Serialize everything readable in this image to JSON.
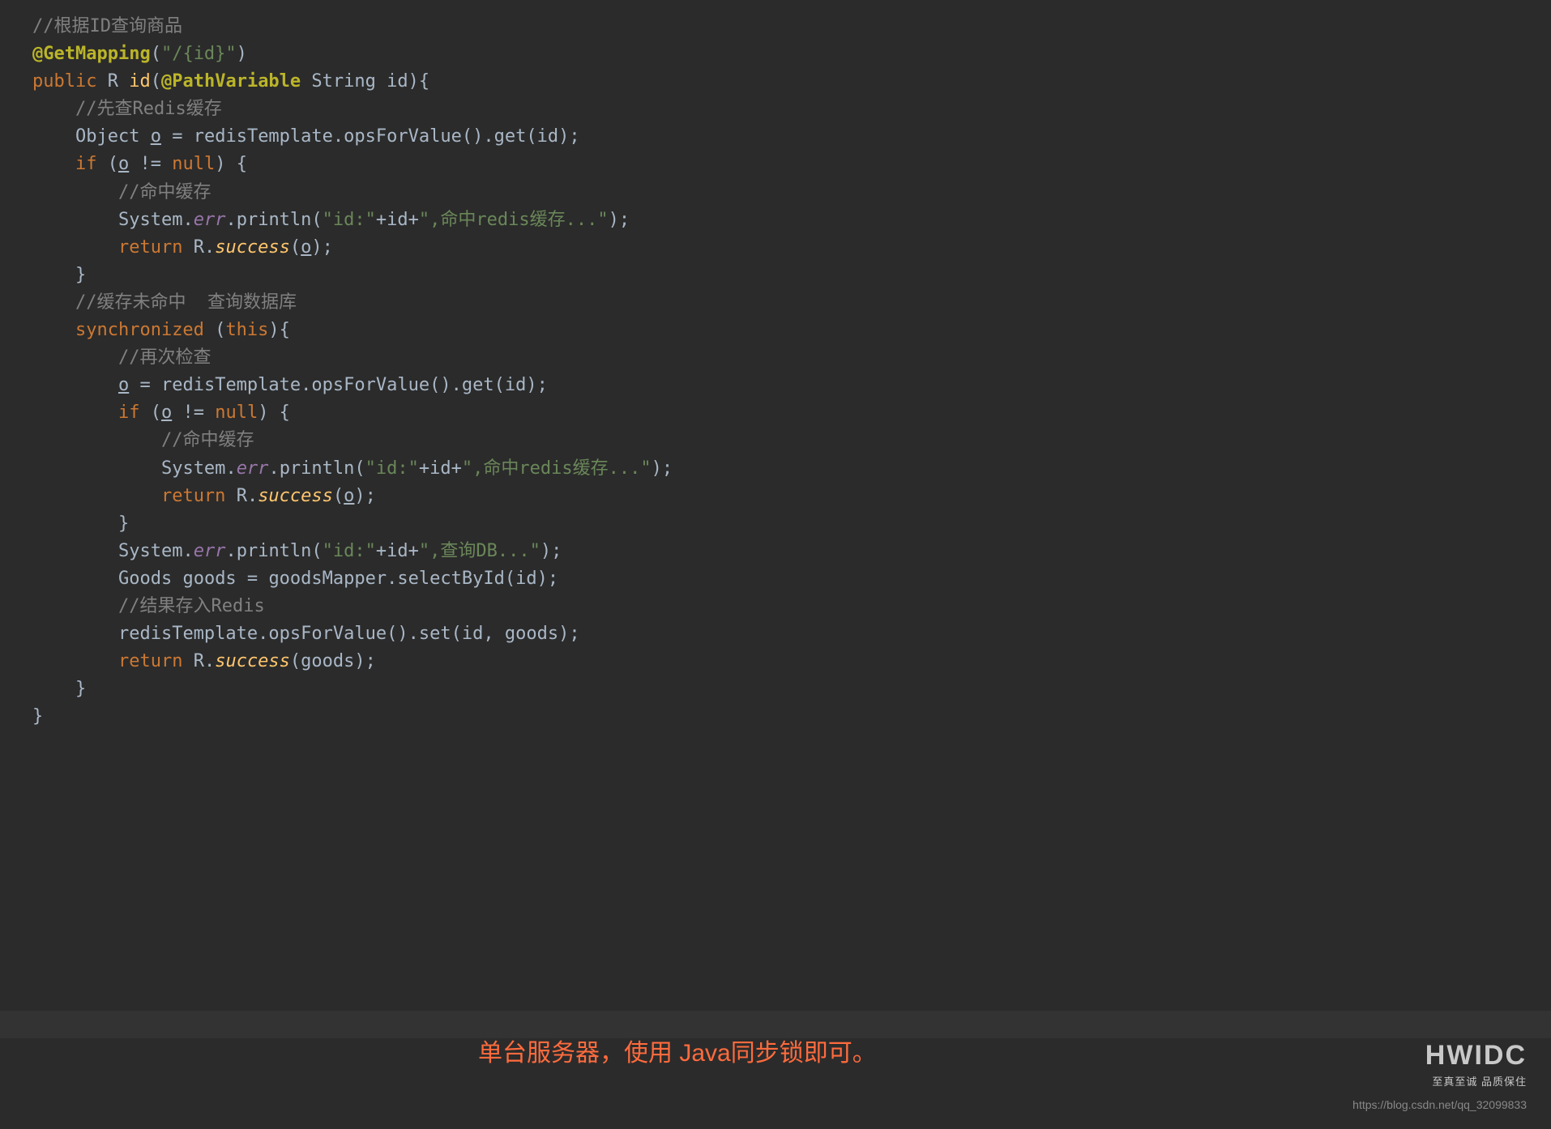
{
  "code": {
    "line1_comment": "//根据ID查询商品",
    "line2_annotation": "@GetMapping",
    "line2_string": "\"/{id}\"",
    "line3_kw_public": "public",
    "line3_type_R": "R",
    "line3_method": "id",
    "line3_anno": "@PathVariable",
    "line3_param_type": "String",
    "line3_param_name": "id",
    "line4_comment": "//先查Redis缓存",
    "line5_type": "Object",
    "line5_var": "o",
    "line5_eq": " = ",
    "line5_redis": "redisTemplate",
    "line5_m1": "opsForValue",
    "line5_m2": "get",
    "line5_arg": "id",
    "line6_kw": "if",
    "line6_cond_var": "o",
    "line6_cond_op": " != ",
    "line6_cond_null": "null",
    "line7_comment": "//命中缓存",
    "line8_sys": "System",
    "line8_err": "err",
    "line8_println": "println",
    "line8_str1": "\"id:\"",
    "line8_plus": "+id+",
    "line8_str2": "\",命中redis缓存...\"",
    "line9_return": "return",
    "line9_R": "R",
    "line9_success": "success",
    "line9_arg": "o",
    "line11_comment": "//缓存未命中  查询数据库",
    "line12_sync": "synchronized",
    "line12_this": "this",
    "line13_comment": "//再次检查",
    "line14_var": "o",
    "line14_redis": "redisTemplate",
    "line14_m1": "opsForValue",
    "line14_m2": "get",
    "line14_arg": "id",
    "line15_kw": "if",
    "line15_var": "o",
    "line15_null": "null",
    "line16_comment": "//命中缓存",
    "line17_str1": "\"id:\"",
    "line17_str2": "\",命中redis缓存...\"",
    "line18_return": "return",
    "line18_success": "success",
    "line18_arg": "o",
    "line20_str1": "\"id:\"",
    "line20_str2": "\",查询DB...\"",
    "line21_type": "Goods",
    "line21_var": "goods",
    "line21_mapper": "goodsMapper",
    "line21_method": "selectById",
    "line21_arg": "id",
    "line22_comment": "//结果存入Redis",
    "line23_redis": "redisTemplate",
    "line23_m1": "opsForValue",
    "line23_m2": "set",
    "line23_a1": "id",
    "line23_a2": "goods",
    "line24_return": "return",
    "line24_success": "success",
    "line24_arg": "goods"
  },
  "overlay": {
    "note": "单台服务器，使用 Java同步锁即可。"
  },
  "watermark": {
    "brand": "HWIDC",
    "tagline": "至真至诚 品质保住",
    "url": "https://blog.csdn.net/qq_32099833"
  }
}
